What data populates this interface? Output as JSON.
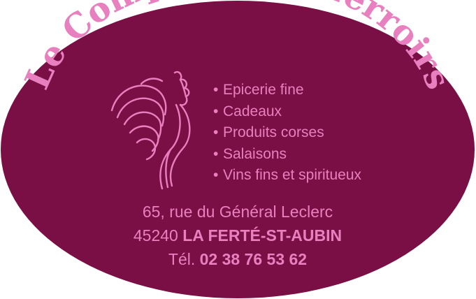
{
  "brand": {
    "name": "Le Comptoir des Terroirs",
    "colors": {
      "background": "#7a0f45",
      "accent": "#e880c0"
    }
  },
  "products": [
    {
      "bullet": "•",
      "label": "Epicerie fine"
    },
    {
      "bullet": "•",
      "label": "Cadeaux"
    },
    {
      "bullet": "•",
      "label": "Produits corses"
    },
    {
      "bullet": "•",
      "label": "Salaisons"
    },
    {
      "bullet": "•",
      "label": "Vins fins et spiritueux"
    }
  ],
  "address": {
    "street": "65, rue du Général Leclerc",
    "postal_code": "45240",
    "city": "LA FERTÉ-ST-AUBIN",
    "phone_label": "Tél.",
    "phone": "02 38 76 53 62"
  },
  "icons": {
    "logo": "rooster-icon"
  }
}
